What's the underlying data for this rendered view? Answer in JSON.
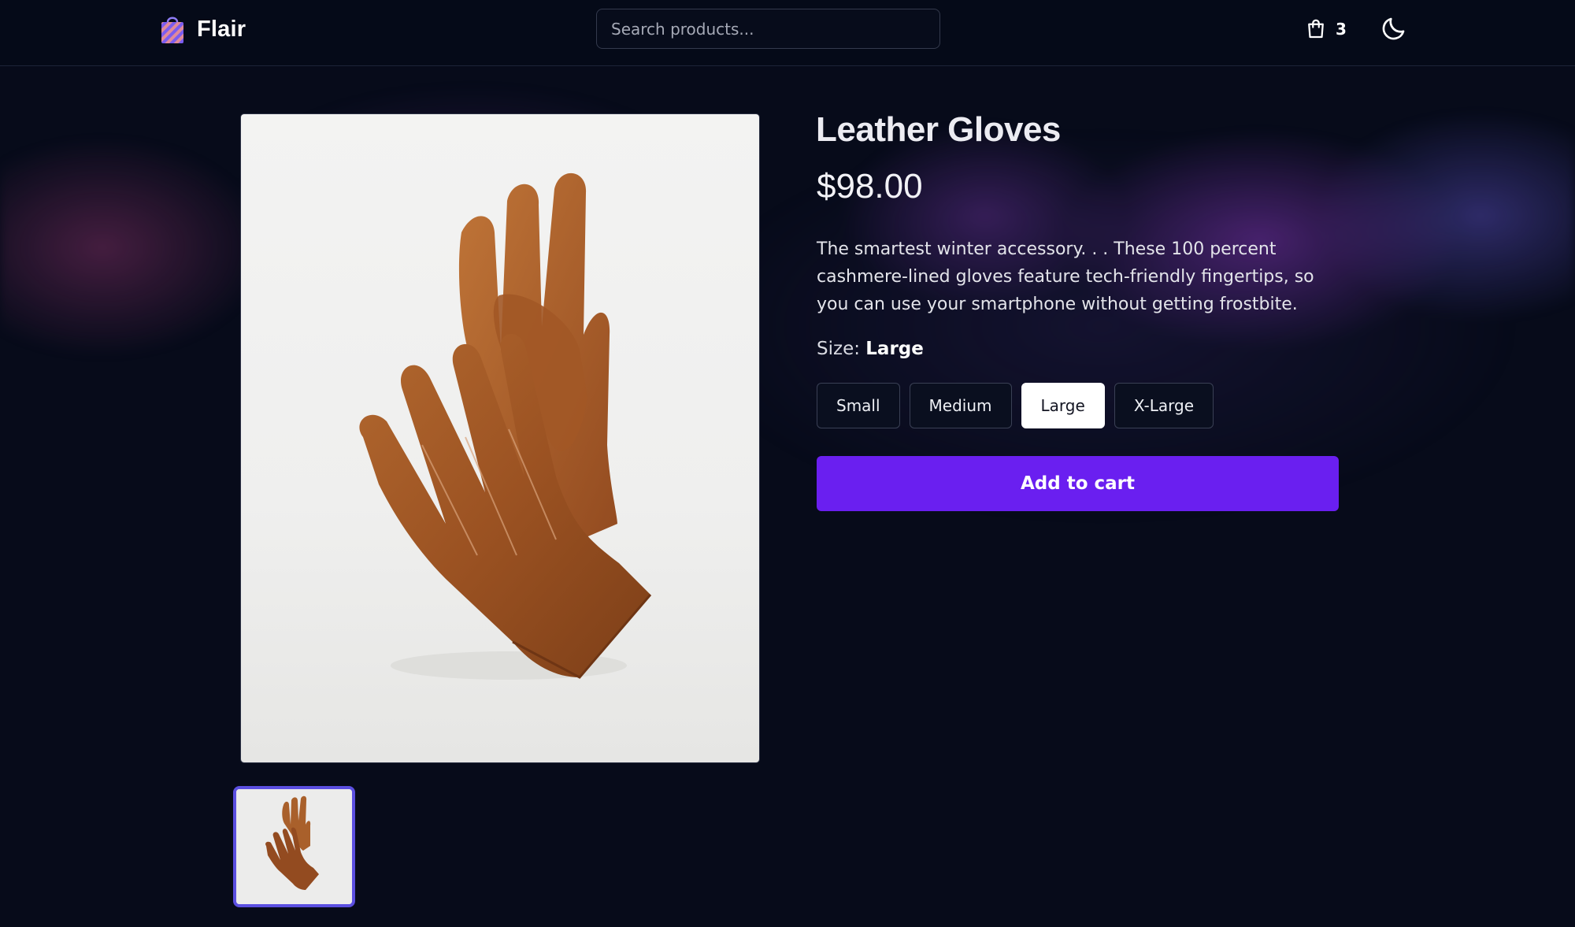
{
  "header": {
    "brand": "Flair",
    "search_placeholder": "Search products...",
    "cart_count": "3"
  },
  "product": {
    "title": "Leather Gloves",
    "price": "$98.00",
    "description": "The smartest winter accessory. . . These 100 percent cashmere-lined gloves feature tech-friendly fingertips, so you can use your smartphone without getting frostbite.",
    "size_label": "Size:",
    "selected_size": "Large",
    "sizes": [
      "Small",
      "Medium",
      "Large",
      "X-Large"
    ],
    "add_to_cart_label": "Add to cart"
  },
  "colors": {
    "accent": "#6a1ff0",
    "thumb_border": "#5b4fe0",
    "background": "#070b1a"
  },
  "icons": {
    "brand": "shopping-bag-icon",
    "cart": "shopping-bag-outline-icon",
    "theme": "moon-icon"
  }
}
